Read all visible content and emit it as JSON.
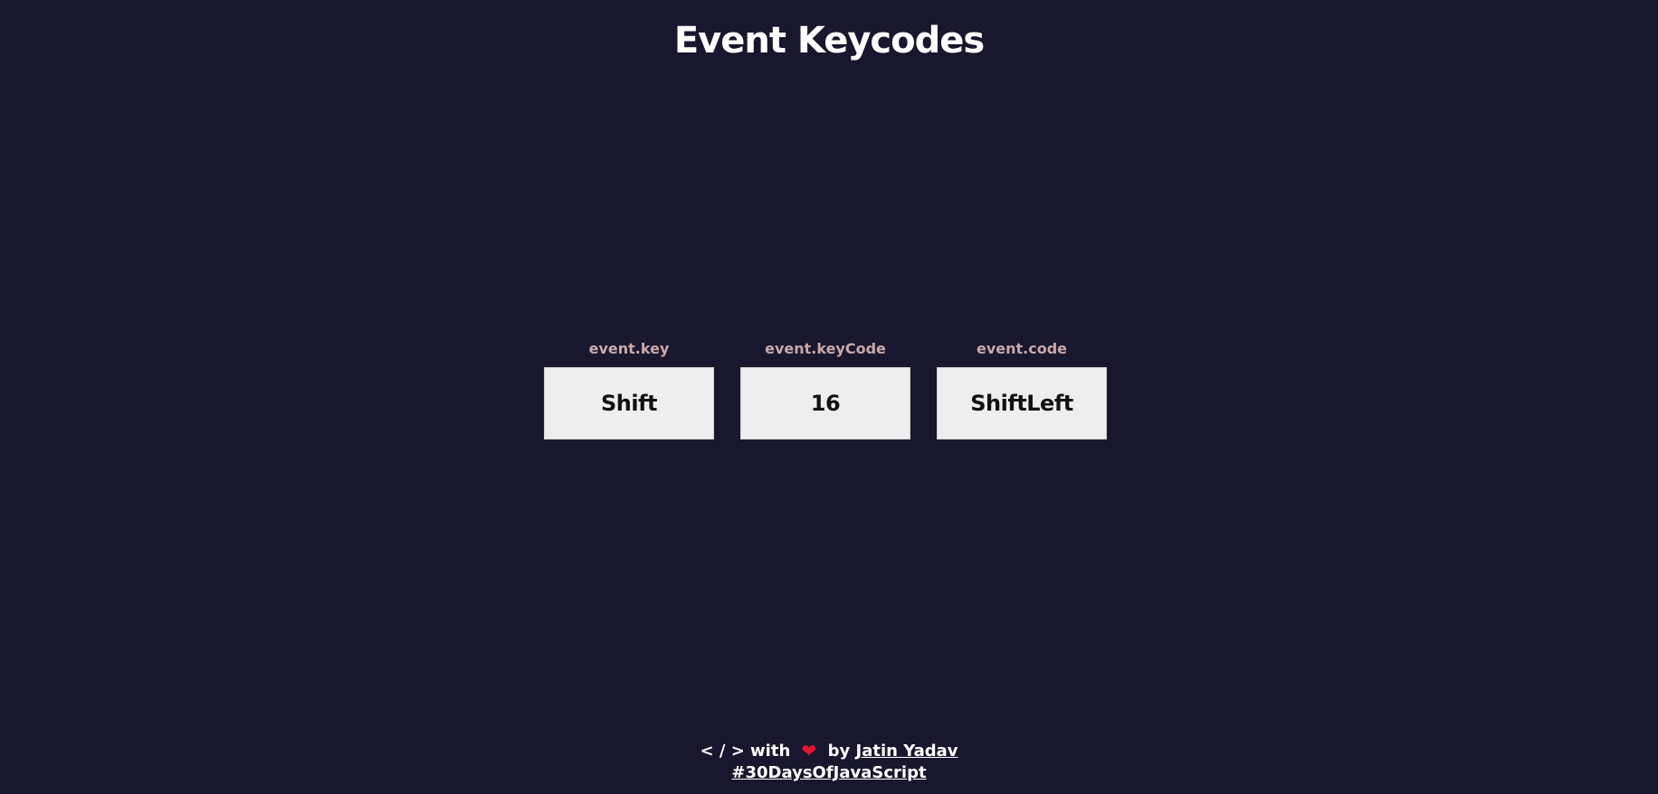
{
  "header": {
    "title": "Event Keycodes"
  },
  "cards": [
    {
      "label": "event.key",
      "value": "Shift"
    },
    {
      "label": "event.keyCode",
      "value": "16"
    },
    {
      "label": "event.code",
      "value": "ShiftLeft"
    }
  ],
  "footer": {
    "prefix": "< / > with",
    "heart_icon": "heart-icon",
    "by": "by",
    "author_link": "Jatin Yadav",
    "hashtag_link": "#30DaysOfJavaScript"
  },
  "colors": {
    "background": "#19172d",
    "label": "#c9a9a9",
    "card_background": "#eeeeee",
    "heart": "#e3152b"
  }
}
